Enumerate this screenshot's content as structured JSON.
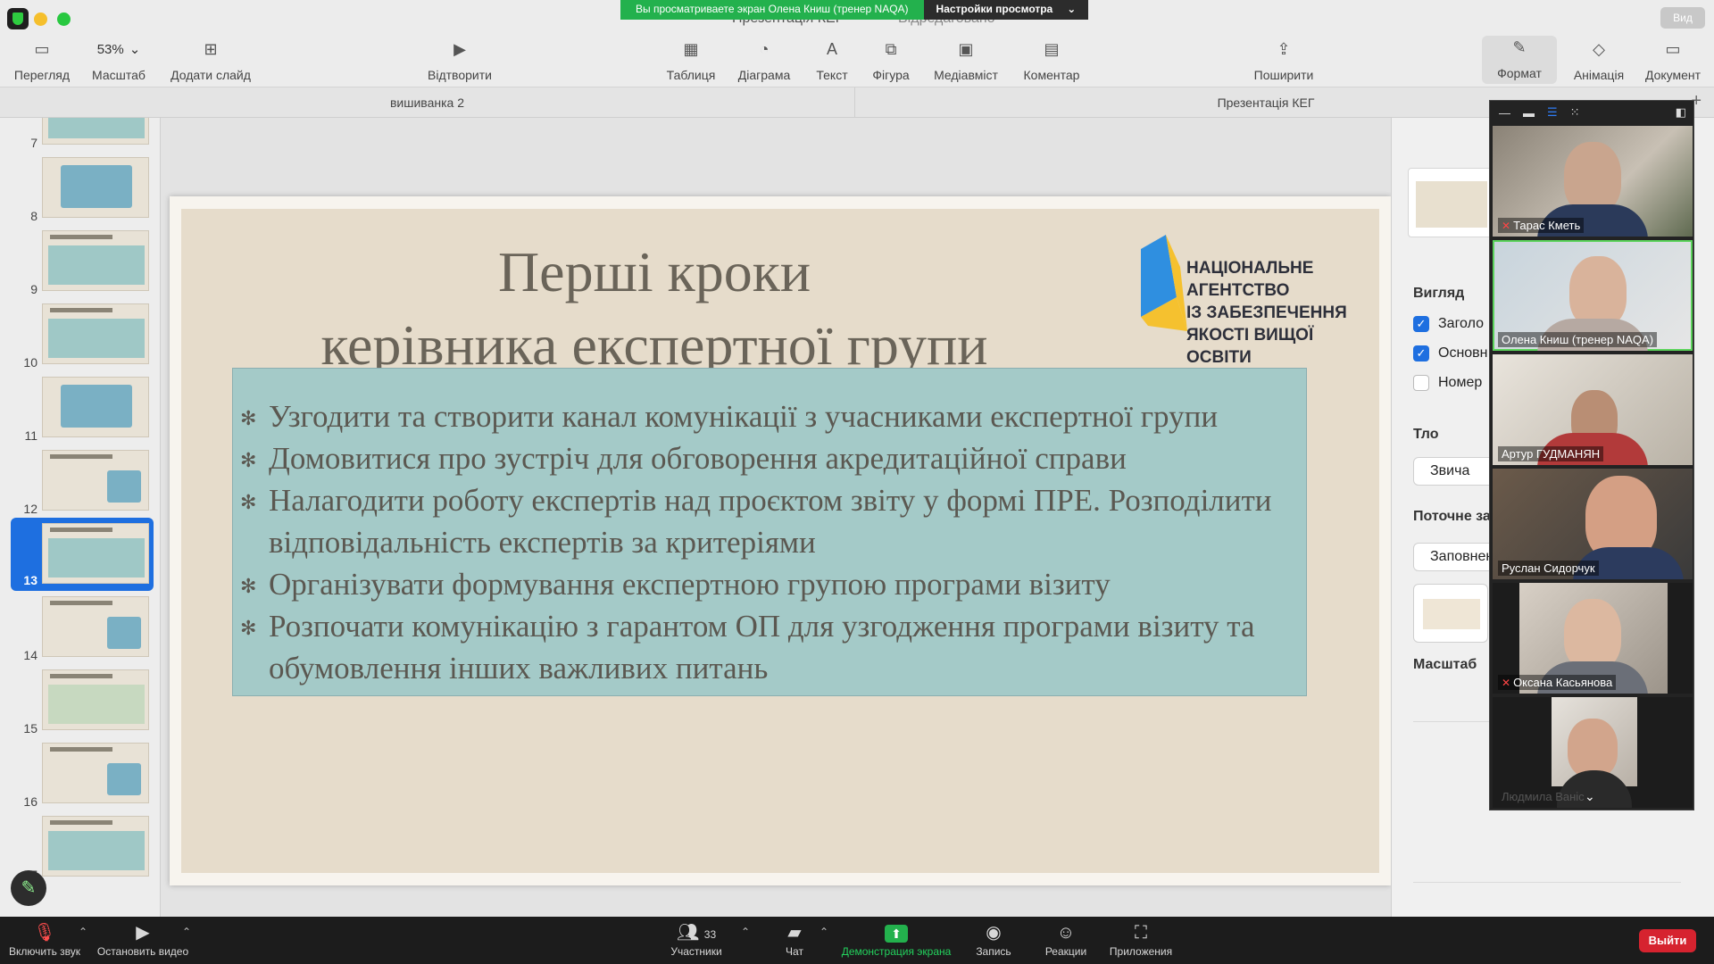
{
  "window": {
    "document_title": "Презентація КЕГ",
    "edited_label": "Відредаговано",
    "view_button": "Вид"
  },
  "share_banner": {
    "message": "Вы просматриваете экран Олена Книш (тренер NAQA)",
    "options": "Настройки просмотра"
  },
  "toolbar": {
    "view": "Перегляд",
    "zoom_value": "53%",
    "zoom": "Масштаб",
    "add_slide": "Додати слайд",
    "play": "Відтворити",
    "table": "Таблиця",
    "chart": "Діаграма",
    "text": "Текст",
    "shape": "Фігура",
    "media": "Медіавміст",
    "comment": "Коментар",
    "share": "Поширити",
    "format": "Формат",
    "animate": "Анімація",
    "document": "Документ"
  },
  "tabs": [
    "вишиванка 2",
    "Презентація КЕГ"
  ],
  "navigator": {
    "slides": [
      "7",
      "8",
      "9",
      "10",
      "11",
      "12",
      "13",
      "14",
      "15",
      "16",
      "17"
    ],
    "selected": "13"
  },
  "slide": {
    "title_line1": "Перші кроки",
    "title_line2": "керівника експертної групи",
    "logo_line1": "НАЦІОНАЛЬНЕ",
    "logo_line2": "АГЕНТСТВО",
    "logo_line3": "ІЗ ЗАБЕЗПЕЧЕННЯ",
    "logo_line4": "ЯКОСТІ ВИЩОЇ ОСВІТИ",
    "bullets": [
      "Узгодити та створити канал комунікації з учасниками експертної групи",
      "Домовитися про зустріч для обговорення акредитаційної справи",
      "Налагодити роботу експертів над проєктом звіту у формі ПРЕ. Розподілити відповідальність експертів за критеріями",
      "Організувати формування експертною групою програми візиту",
      "Розпочати комунікацію з гарантом ОП для узгодження програми візиту та обумовлення інших важливих питань"
    ]
  },
  "inspector": {
    "appearance": "Вигляд",
    "check_title": "Заголо",
    "check_body": "Основн",
    "check_number": "Номер",
    "background": "Тло",
    "background_value": "Звича",
    "current": "Поточне за",
    "current_value": "Заповнен",
    "scale": "Масштаб"
  },
  "participants": [
    {
      "name": "Тарас Кметь",
      "muted": true
    },
    {
      "name": "Олена Книш (тренер NAQA)",
      "muted": false
    },
    {
      "name": "Артур ГУДМАНЯН",
      "muted": false
    },
    {
      "name": "Руслан Сидорчук",
      "muted": false
    },
    {
      "name": "Оксана Касьянова",
      "muted": true
    },
    {
      "name": "Людмила Ваніс",
      "muted": false
    }
  ],
  "zoombar": {
    "audio": "Включить звук",
    "video": "Остановить видео",
    "participants_count": "33",
    "participants": "Участники",
    "chat": "Чат",
    "share": "Демонстрация экрана",
    "record": "Запись",
    "reactions": "Реакции",
    "apps": "Приложения",
    "leave": "Выйти"
  },
  "colors": {
    "accent": "#1e6fe0",
    "share_green": "#23b14d",
    "leave_red": "#d6232f",
    "slide_box": "#a4cac8",
    "logo_blue": "#2f8fe0",
    "logo_yellow": "#f5c12f"
  }
}
